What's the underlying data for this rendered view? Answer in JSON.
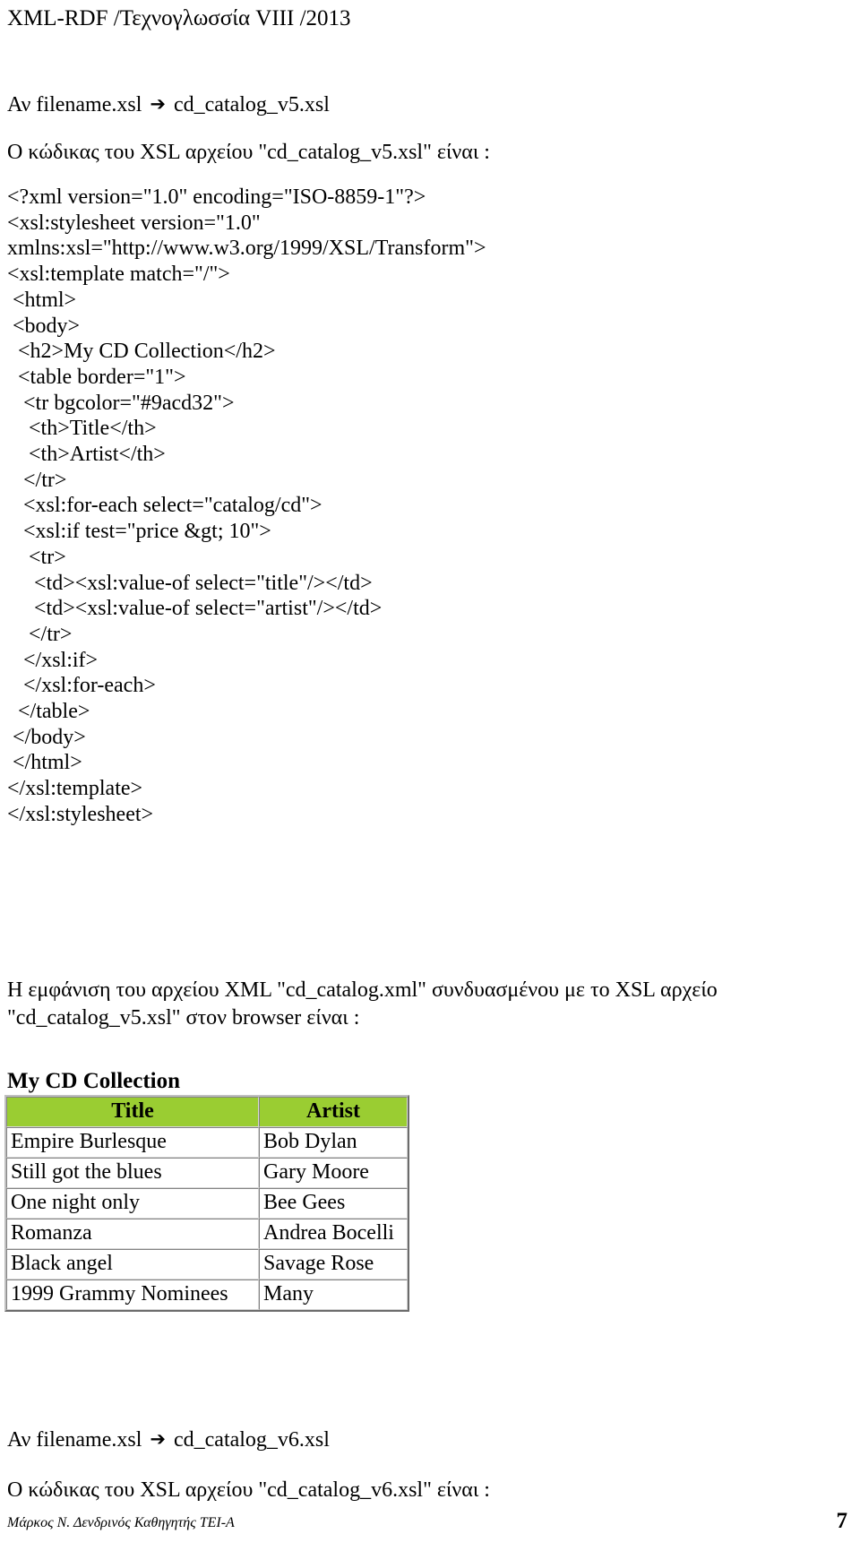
{
  "header": {
    "running_head": "XML-RDF /Τεχνογλωσσία VIII /2013"
  },
  "sections": {
    "filename_line_top_prefix": "Αν filename.xsl ",
    "filename_line_top_arrow": "➔",
    "filename_line_top_value": " cd_catalog_v5.xsl",
    "code_intro": "Ο κώδικας του XSL αρχείου \"cd_catalog_v5.xsl\" είναι :",
    "render_intro": "Η εμφάνιση του αρχείου XML \"cd_catalog.xml\" συνδυασμένου με το XSL αρχείο \"cd_catalog_v5.xsl\" στον browser είναι :",
    "filename_line_bottom_prefix": "Αν filename.xsl ",
    "filename_line_bottom_arrow": "➔",
    "filename_line_bottom_value": " cd_catalog_v6.xsl",
    "code_intro_bottom": "Ο κώδικας του XSL αρχείου \"cd_catalog_v6.xsl\" είναι :"
  },
  "code_listing": {
    "lines": [
      "<?xml version=\"1.0\" encoding=\"ISO-8859-1\"?>",
      "<xsl:stylesheet version=\"1.0\"",
      "xmlns:xsl=\"http://www.w3.org/1999/XSL/Transform\">",
      "<xsl:template match=\"/\">",
      " <html>",
      " <body>",
      "  <h2>My CD Collection</h2>",
      "  <table border=\"1\">",
      "   <tr bgcolor=\"#9acd32\">",
      "    <th>Title</th>",
      "    <th>Artist</th>",
      "   </tr>",
      "   <xsl:for-each select=\"catalog/cd\">",
      "   <xsl:if test=\"price &gt; 10\">",
      "    <tr>",
      "     <td><xsl:value-of select=\"title\"/></td>",
      "     <td><xsl:value-of select=\"artist\"/></td>",
      "    </tr>",
      "   </xsl:if>",
      "   </xsl:for-each>",
      "  </table>",
      " </body>",
      " </html>",
      "</xsl:template>",
      "</xsl:stylesheet>"
    ]
  },
  "browser_output": {
    "heading": "My CD Collection",
    "header_bgcolor": "#9acd32",
    "columns": [
      "Title",
      "Artist"
    ],
    "rows": [
      [
        "Empire Burlesque",
        "Bob Dylan"
      ],
      [
        "Still got the blues",
        "Gary Moore"
      ],
      [
        "One night only",
        "Bee Gees"
      ],
      [
        "Romanza",
        "Andrea Bocelli"
      ],
      [
        "Black angel",
        "Savage Rose"
      ],
      [
        "1999 Grammy Nominees",
        "Many"
      ]
    ]
  },
  "footer": {
    "note": "Μάρκος Ν. Δενδρινός Καθηγητής ΤΕΙ-Α",
    "page_number": "7"
  }
}
